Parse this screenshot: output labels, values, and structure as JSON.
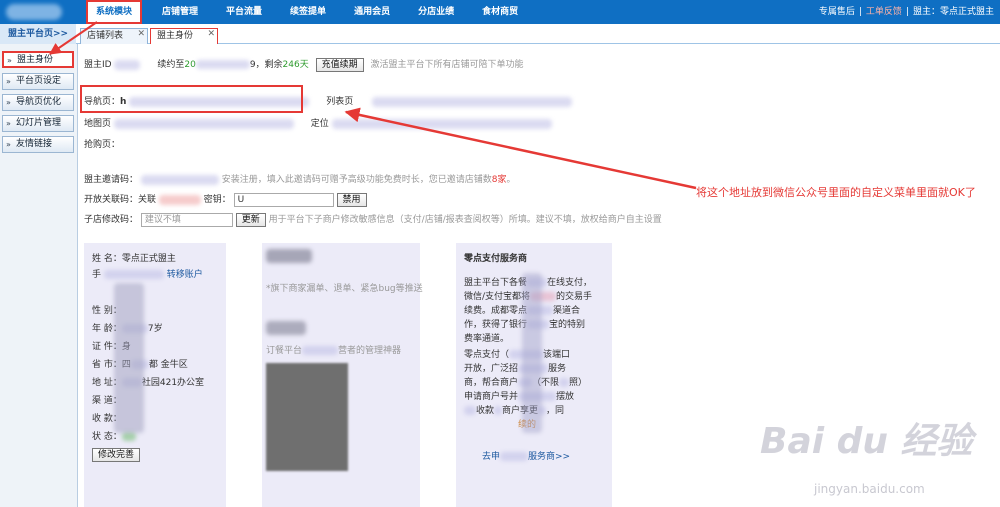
{
  "topnav": {
    "items": [
      "系统模块",
      "店铺管理",
      "平台流量",
      "续签提单",
      "通用会员",
      "分店业绩",
      "食材商贸"
    ],
    "active": 0
  },
  "topright": {
    "link1": "专属售后",
    "sep": "|",
    "link2": "工单反馈",
    "sep2": "|",
    "user": "盟主：零点正式盟主"
  },
  "breadcrumb": "盟主平台页>>",
  "tabs": [
    {
      "label": "店铺列表"
    },
    {
      "label": "盟主身份"
    }
  ],
  "sidebar": {
    "items": [
      "盟主身份",
      "平台页设定",
      "导航页优化",
      "幻灯片管理",
      "友情链接"
    ],
    "active": 0
  },
  "info": {
    "id_label": "盟主ID",
    "renew_prefix": "续约至",
    "renew_date": "20",
    "renew_tail": "9，剩余",
    "days": "246天",
    "renew_button": "充值续期",
    "renew_hint": "激活盟主平台下所有店铺可陪下单功能",
    "nav_label": "导航页：",
    "nav_value": "h",
    "list_label": "列表页",
    "map_label": "地图页",
    "loc_label": "定位",
    "grab_label": "抢购页："
  },
  "invite": {
    "code_label": "盟主邀请码：",
    "code_hint": "安装注册，填入此邀请码可赠予高级功能免费时长，您已邀请店铺数",
    "count": "8家",
    "dot": "。",
    "open_label": "开放关联码：",
    "open_rel": "关联",
    "key_label": "密钥：",
    "key_value": "U",
    "ban_button": "禁用",
    "sub_label": "子店修改码：",
    "sub_placeholder": "建议不填",
    "update_button": "更新",
    "sub_hint": "用于平台下子商户修改敏感信息（支付/店铺/报表查阅权等）所填。建议不填，放权给商户自主设置"
  },
  "profile": {
    "name_line": "姓 名：零点正式盟主",
    "phone_label": "手",
    "transfer_link": "转移账户",
    "gender_label": "性 别：",
    "age_line": "年 龄：",
    "age_tail": "7岁",
    "cert_label": "证 件：身",
    "province_label": "省 市：四",
    "province_tail": "都 金牛区",
    "addr_label": "地 址：",
    "addr_tail": "社园421办公室",
    "channel_label": "渠 道：",
    "income_label": "收 款：",
    "status_label": "状 态：",
    "edit_button": "修改完善"
  },
  "mid": {
    "hint": "*旗下商家漏单、退单、紧急bug等推送",
    "line2_a": "订餐平台",
    "line2_b": "营者的管理神器"
  },
  "pay": {
    "title": "零点支付服务商",
    "p1": "盟主平台下各餐",
    "p1b": "在线支付，",
    "p2": "微信/支付宝都将",
    "p2b": "的交易手",
    "p3": "续费。成都零点",
    "p3b": "渠道合",
    "p4": "作，获得了银行",
    "p4b": "宝的特别",
    "p5": "费率通道。",
    "p6": "零点支付（",
    "p6b": "该端口",
    "p7": "开放，广泛招",
    "p7b": "服务",
    "p8": "商，帮合商户",
    "p8b": "（不限",
    "p8c": "照）",
    "p9": "申请商户号并",
    "p9b": "摆放",
    "p10": "收款",
    "p10b": "商户享更",
    "p10c": "，同",
    "p11": "续的",
    "footer": "去申",
    "footer_b": "服务商>>"
  },
  "annotation": "将这个地址放到微信公众号里面的自定义菜单里面就OK了",
  "watermark": {
    "logo": "Bai du 经验",
    "url": "jingyan.baidu.com"
  }
}
